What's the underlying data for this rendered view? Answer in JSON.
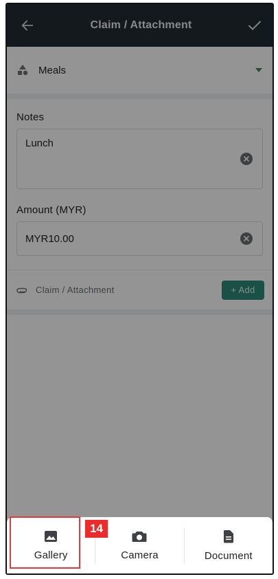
{
  "appbar": {
    "title": "Claim / Attachment",
    "back_icon": "arrow-left-icon",
    "confirm_icon": "check-icon"
  },
  "category": {
    "icon": "shapes-icon",
    "label": "Meals",
    "dropdown_icon": "caret-down-icon"
  },
  "notes": {
    "label": "Notes",
    "value": "Lunch"
  },
  "amount": {
    "label": "Amount (MYR)",
    "value": "MYR10.00"
  },
  "attachment": {
    "icon": "paperclip-icon",
    "label": "Claim / Attachment",
    "add_label": "+ Add"
  },
  "sheet": {
    "items": [
      {
        "label": "Gallery",
        "icon": "image-icon"
      },
      {
        "label": "Camera",
        "icon": "camera-icon"
      },
      {
        "label": "Document",
        "icon": "document-icon"
      }
    ]
  },
  "annotation": {
    "badge": "14"
  },
  "colors": {
    "appbar": "#232b34",
    "accent": "#2e8b78",
    "dropdown_caret": "#3a8a4a",
    "highlight": "#e53a3a"
  }
}
